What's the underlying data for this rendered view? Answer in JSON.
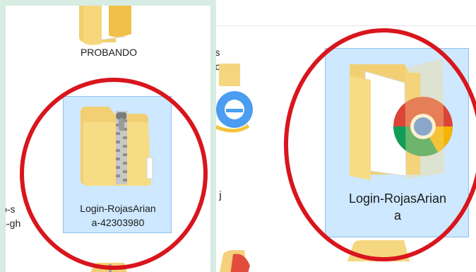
{
  "left_panel": {
    "folder_probando": {
      "label": "PROBANDO"
    },
    "zip_file": {
      "label_line1": "Login-RojasArian",
      "label_line2": "a-42303980"
    },
    "cut_left_label_1": "p-s",
    "cut_left_label_2": "s-gh"
  },
  "middle_strip": {
    "cut_label_1": "s",
    "cut_label_2": "c",
    "cut_label_3": "j"
  },
  "right_panel": {
    "folder": {
      "label_line1": "Login-RojasArian",
      "label_line2": "a"
    }
  },
  "colors": {
    "panel_border": "#d7ece3",
    "selection_fill": "#cde8ff",
    "selection_border": "#8fc0ea",
    "annotation_circle": "#d9151d",
    "folder_yellow": "#f3d176"
  }
}
